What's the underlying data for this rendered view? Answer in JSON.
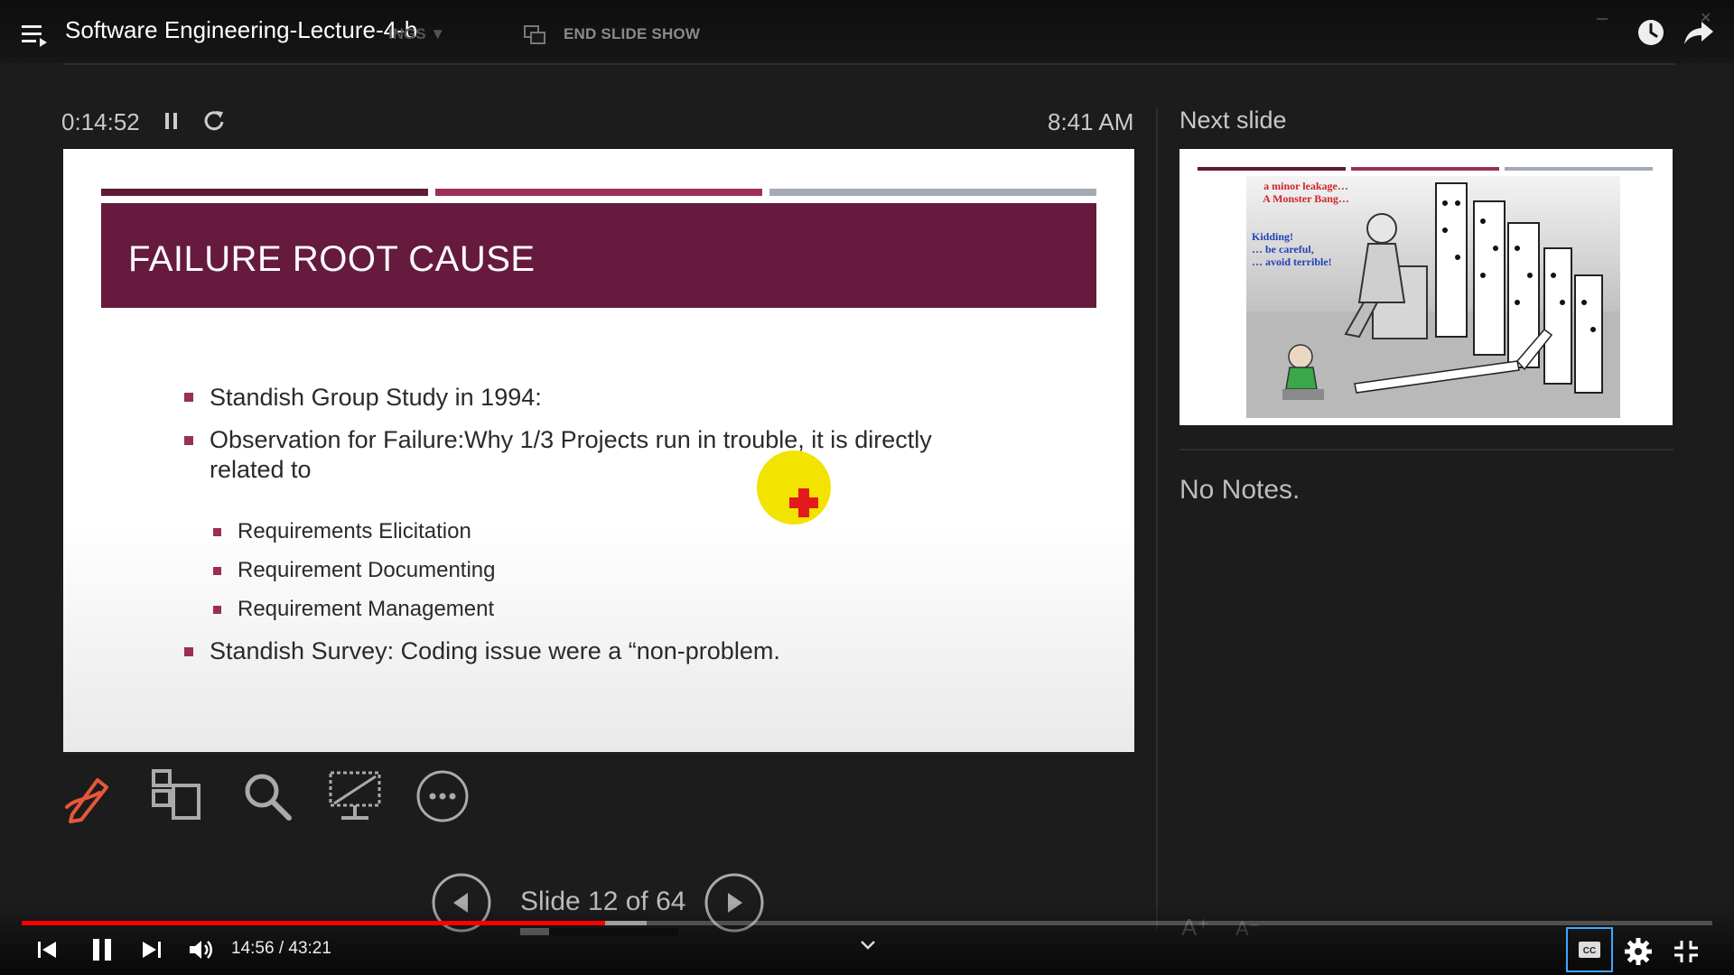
{
  "video": {
    "title": "Software Engineering-Lecture-4-b",
    "faded_menu": "INGS ▼",
    "end_slide_show": "END SLIDE SHOW",
    "current_time": "14:56",
    "duration": "43:21",
    "time_display": "14:56 / 43:21",
    "progress_fraction": 0.345
  },
  "presenter": {
    "timer": "0:14:52",
    "clock": "8:41 AM",
    "next_slide_label": "Next slide",
    "notes": "No Notes.",
    "slide_counter": "Slide 12 of 64",
    "text_larger": "A",
    "text_smaller": "A"
  },
  "current_slide": {
    "title": "FAILURE ROOT CAUSE",
    "bullets": [
      "Standish Group Study in 1994:",
      "Observation for Failure:Why 1/3 Projects run in trouble, it is directly",
      "related to",
      "Standish Survey: Coding issue were a “non-problem."
    ],
    "sub_bullets": [
      "Requirements Elicitation",
      "Requirement Documenting",
      "Requirement Management"
    ]
  },
  "next_slide": {
    "caption_red": [
      "a minor leakage…",
      "A Monster Bang…"
    ],
    "caption_blue": [
      "Kidding!",
      "… be careful,",
      "… avoid terrible!"
    ]
  },
  "colors": {
    "slide_title_band": "#661a3e",
    "bullet": "#9a2e56",
    "accent_bar_1": "#5e1a36",
    "accent_bar_2": "#9c2f59",
    "accent_bar_3": "#a3aab4",
    "pen_tool": "#e8573a",
    "laser_pointer": "#f2e300",
    "progress_played": "#ff0000",
    "cc_highlight": "#3ea6ff"
  },
  "icons": {
    "playlist": "playlist-icon",
    "watch_later": "clock-icon",
    "share": "share-arrow-icon",
    "pen": "pen-icon",
    "see_all_slides": "slides-grid-icon",
    "zoom": "magnifier-icon",
    "black_screen": "screen-icon",
    "more": "more-options-icon"
  }
}
